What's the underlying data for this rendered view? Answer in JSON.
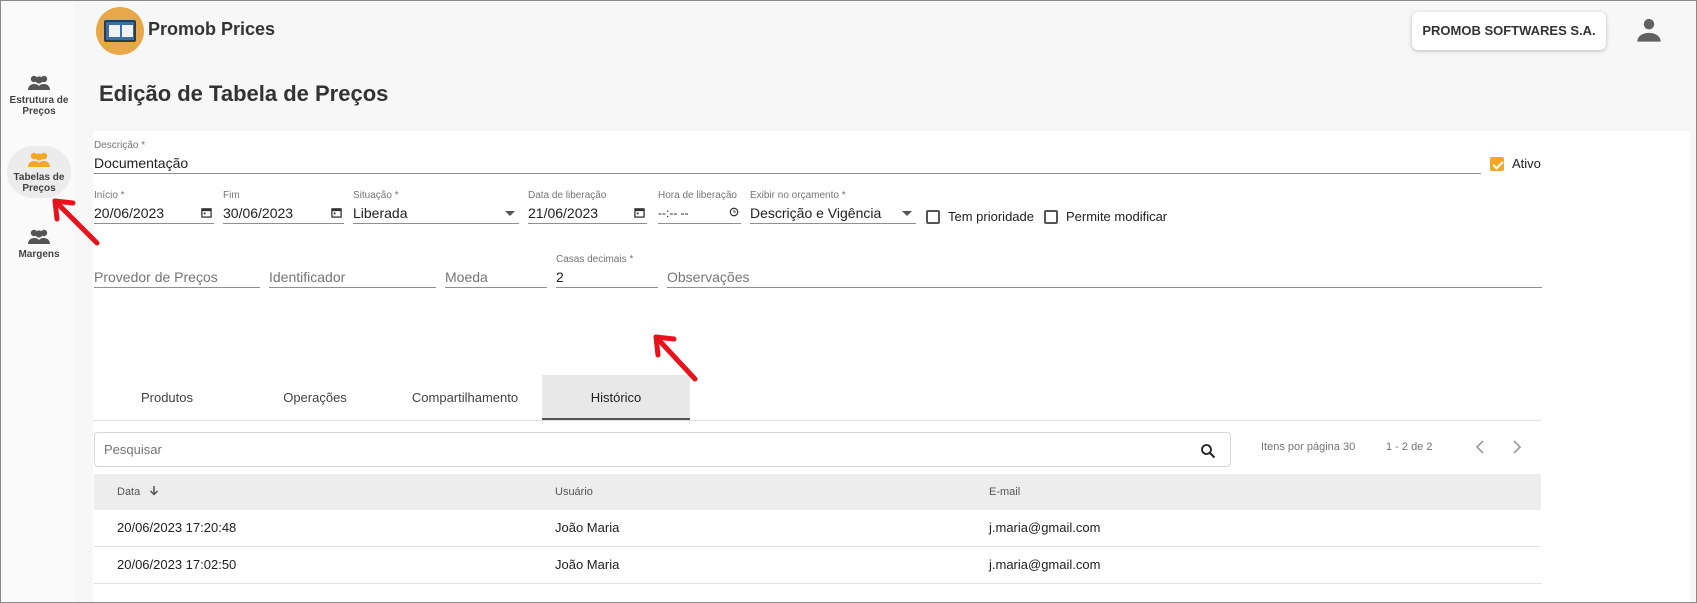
{
  "header": {
    "app_title": "Promob Prices",
    "company": "PROMOB SOFTWARES S.A."
  },
  "sidebar": {
    "items": [
      {
        "label": "Estrutura de Preços",
        "icon": "group-icon",
        "active": false
      },
      {
        "label": "Tabelas de Preços",
        "icon": "group-icon",
        "active": true
      },
      {
        "label": "Margens",
        "icon": "group-icon",
        "active": false
      }
    ]
  },
  "page": {
    "title": "Edição de Tabela de Preços"
  },
  "form": {
    "descricao": {
      "label": "Descrição *",
      "value": "Documentação"
    },
    "ativo": {
      "label": "Ativo",
      "checked": true
    },
    "inicio": {
      "label": "Início *",
      "value": "20/06/2023"
    },
    "fim": {
      "label": "Fim",
      "value": "30/06/2023"
    },
    "situacao": {
      "label": "Situação *",
      "value": "Liberada"
    },
    "data_liberacao": {
      "label": "Data de liberação",
      "value": "21/06/2023"
    },
    "hora_liberacao": {
      "label": "Hora de liberação",
      "value": "--:-- --"
    },
    "exibir_orcamento": {
      "label": "Exibir no orçamento *",
      "value": "Descrição e Vigência"
    },
    "tem_prioridade": {
      "label": "Tem prioridade",
      "checked": false
    },
    "permite_modificar": {
      "label": "Permite modificar",
      "checked": false
    },
    "provedor": {
      "placeholder": "Provedor de Preços"
    },
    "identificador": {
      "placeholder": "Identificador"
    },
    "moeda": {
      "placeholder": "Moeda"
    },
    "casas_decimais": {
      "label": "Casas decimais *",
      "value": "2"
    },
    "observacoes": {
      "placeholder": "Observações"
    }
  },
  "tabs": [
    {
      "label": "Produtos",
      "active": false
    },
    {
      "label": "Operações",
      "active": false
    },
    {
      "label": "Compartilhamento",
      "active": false
    },
    {
      "label": "Histórico",
      "active": true
    }
  ],
  "history": {
    "search_placeholder": "Pesquisar",
    "items_per_page_label": "Itens por página",
    "items_per_page": "30",
    "range": "1 - 2 de 2",
    "columns": [
      "Data",
      "Usuário",
      "E-mail"
    ],
    "rows": [
      {
        "data": "20/06/2023 17:20:48",
        "usuario": "João Maria",
        "email": "j.maria@gmail.com"
      },
      {
        "data": "20/06/2023 17:02:50",
        "usuario": "João Maria",
        "email": "j.maria@gmail.com"
      }
    ]
  },
  "colors": {
    "accent": "#f5a623",
    "annotation": "#e8121c"
  }
}
